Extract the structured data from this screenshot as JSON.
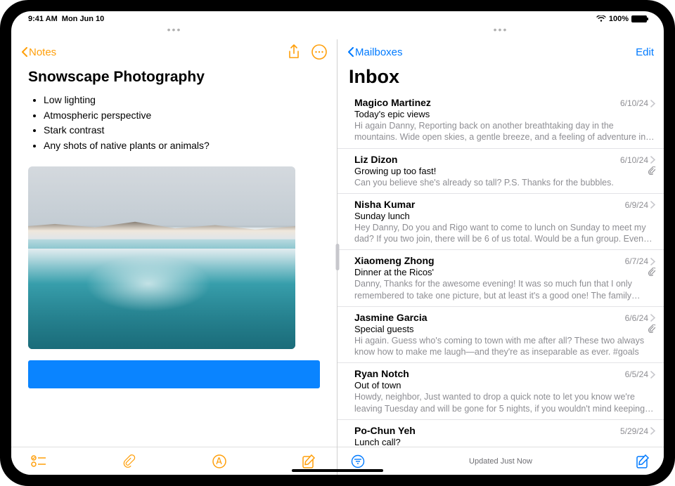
{
  "statusbar": {
    "time": "9:41 AM",
    "date": "Mon Jun 10",
    "wifi": true,
    "battery_pct": "100%"
  },
  "notes": {
    "back_label": "Notes",
    "title": "Snowscape Photography",
    "bullets": [
      "Low lighting",
      "Atmospheric perspective",
      "Stark contrast",
      "Any shots of native plants or animals?"
    ],
    "toolbar": {
      "checklist": "checklist",
      "attach": "attachment",
      "markup": "markup",
      "compose": "compose"
    },
    "nav_icons": {
      "share": "share",
      "more": "more"
    }
  },
  "mail": {
    "back_label": "Mailboxes",
    "edit_label": "Edit",
    "title": "Inbox",
    "status": "Updated Just Now",
    "messages": [
      {
        "sender": "Magico Martinez",
        "date": "6/10/24",
        "subject": "Today's epic views",
        "preview": "Hi again Danny, Reporting back on another breathtaking day in the mountains. Wide open skies, a gentle breeze, and a feeling of adventure in the air. I felt l…",
        "has_attachment": false
      },
      {
        "sender": "Liz Dizon",
        "date": "6/10/24",
        "subject": "Growing up too fast!",
        "preview": "Can you believe she's already so tall? P.S. Thanks for the bubbles.",
        "has_attachment": true
      },
      {
        "sender": "Nisha Kumar",
        "date": "6/9/24",
        "subject": "Sunday lunch",
        "preview": "Hey Danny, Do you and Rigo want to come to lunch on Sunday to meet my dad? If you two join, there will be 6 of us total. Would be a fun group. Even if…",
        "has_attachment": false
      },
      {
        "sender": "Xiaomeng Zhong",
        "date": "6/7/24",
        "subject": "Dinner at the Ricos'",
        "preview": "Danny, Thanks for the awesome evening! It was so much fun that I only remembered to take one picture, but at least it's a good one! The family and…",
        "has_attachment": true
      },
      {
        "sender": "Jasmine Garcia",
        "date": "6/6/24",
        "subject": "Special guests",
        "preview": "Hi again. Guess who's coming to town with me after all? These two always know how to make me laugh—and they're as inseparable as ever. #goals",
        "has_attachment": true
      },
      {
        "sender": "Ryan Notch",
        "date": "6/5/24",
        "subject": "Out of town",
        "preview": "Howdy, neighbor, Just wanted to drop a quick note to let you know we're leaving Tuesday and will be gone for 5 nights, if you wouldn't mind keeping…",
        "has_attachment": false
      },
      {
        "sender": "Po-Chun Yeh",
        "date": "5/29/24",
        "subject": "Lunch call?",
        "preview": "",
        "has_attachment": false
      }
    ]
  }
}
